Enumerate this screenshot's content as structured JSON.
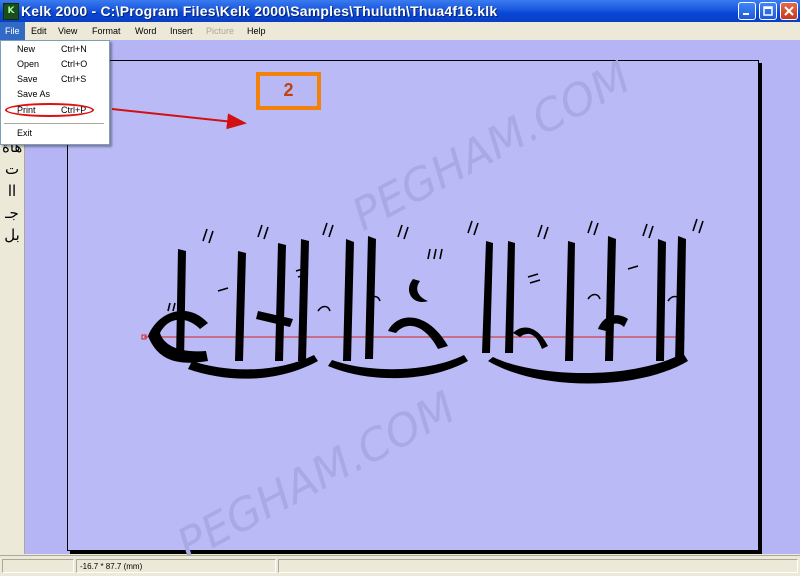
{
  "window": {
    "title": "Kelk 2000 - C:\\Program Files\\Kelk 2000\\Samples\\Thuluth\\Thua4f16.klk",
    "icon_text": "K"
  },
  "menubar": {
    "items": [
      "File",
      "Edit",
      "View",
      "Format",
      "Word",
      "Insert",
      "Picture",
      "Help"
    ],
    "active": "File",
    "disabled": [
      "Picture"
    ]
  },
  "file_menu": {
    "items": [
      {
        "label": "New",
        "shortcut": "Ctrl+N"
      },
      {
        "label": "Open",
        "shortcut": "Ctrl+O"
      },
      {
        "label": "Save",
        "shortcut": "Ctrl+S"
      },
      {
        "label": "Save As",
        "shortcut": ""
      },
      {
        "label": "Print",
        "shortcut": "Ctrl+P"
      },
      {
        "label": "Exit",
        "shortcut": ""
      }
    ]
  },
  "annotation": {
    "step_number": "2",
    "box_color": "#f3820c",
    "arrow_color": "#d11111",
    "highlighted_item": "Print"
  },
  "toolbar_glyphs": [
    "هاة",
    "ت",
    "اا",
    "جـ",
    "بل"
  ],
  "canvas": {
    "calligraphy_text": "إن الدين عند الله الإسلام",
    "watermark": "PEGHAM.COM",
    "baseline_color": "#d62020",
    "background": "#b5b5f5"
  },
  "statusbar": {
    "coords": "-16.7 * 87.7 (mm)"
  },
  "icons": {
    "minimize": "minimize-icon",
    "maximize": "maximize-icon",
    "close": "close-icon"
  }
}
